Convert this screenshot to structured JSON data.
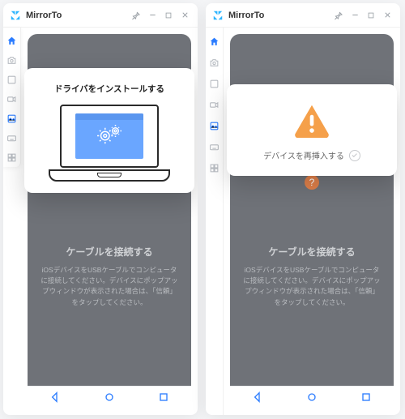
{
  "app": {
    "name": "MirrorTo"
  },
  "titlebar": {
    "pin": "push-pin",
    "minimize": "–",
    "maximize": "□",
    "close": "×"
  },
  "sidebar": {
    "items": [
      {
        "name": "home"
      },
      {
        "name": "camera"
      },
      {
        "name": "screenshot"
      },
      {
        "name": "record"
      },
      {
        "name": "gallery"
      },
      {
        "name": "keyboard"
      },
      {
        "name": "toolbox"
      }
    ]
  },
  "left": {
    "modal_title": "ドライバをインストールする",
    "section_title": "ケーブルを接続する",
    "section_desc": "iOSデバイスをUSBケーブルでコンピュータに接続してください。デバイスにポップアップウィンドウが表示された場合は、「信頼」をタップしてください。"
  },
  "right": {
    "modal_sub": "デバイスを再挿入する",
    "section_title": "ケーブルを接続する",
    "section_desc": "iOSデバイスをUSBケーブルでコンピュータに接続してください。デバイスにポップアップウィンドウが表示された場合は、「信頼」をタップしてください。"
  },
  "nav": {
    "back": "back",
    "home": "home",
    "recent": "recent"
  },
  "help_badge": "?"
}
